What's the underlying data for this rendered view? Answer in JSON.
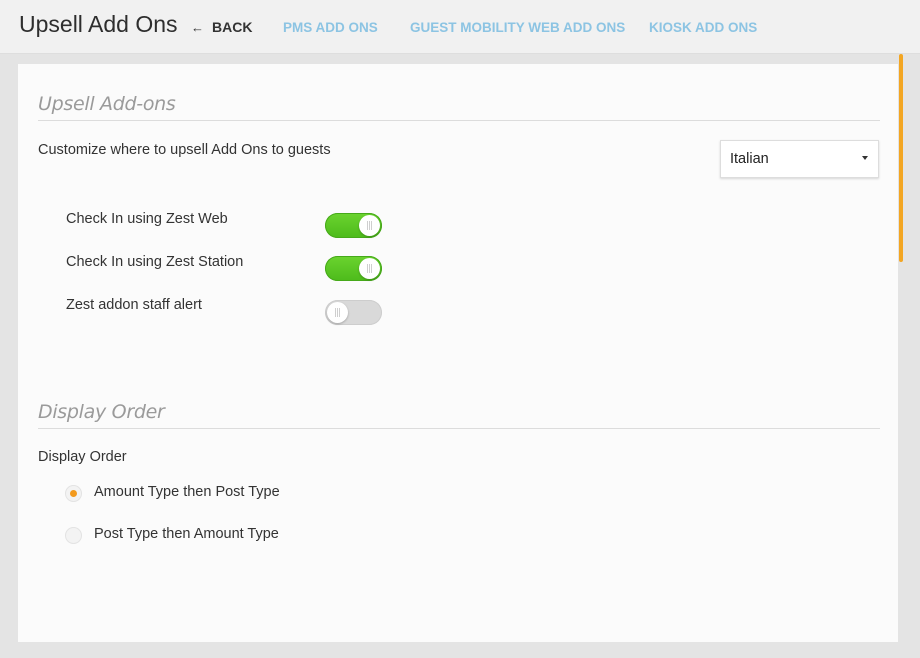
{
  "header": {
    "title": "Upsell Add Ons",
    "back_label": "BACK",
    "tabs": [
      {
        "label": "PMS ADD ONS"
      },
      {
        "label": "GUEST MOBILITY WEB ADD ONS"
      },
      {
        "label": "KIOSK ADD ONS"
      }
    ]
  },
  "upsell_section": {
    "title": "Upsell Add-ons",
    "description": "Customize where to upsell Add Ons to guests",
    "language_select": {
      "selected": "Italian"
    },
    "toggles": [
      {
        "label": "Check In using Zest Web",
        "state": "on"
      },
      {
        "label": "Check In using Zest Station",
        "state": "on"
      },
      {
        "label": "Zest addon staff alert",
        "state": "off"
      }
    ]
  },
  "display_order_section": {
    "title": "Display Order",
    "label": "Display Order",
    "options": [
      {
        "label": "Amount Type then Post Type",
        "selected": true
      },
      {
        "label": "Post Type then Amount Type",
        "selected": false
      }
    ]
  },
  "colors": {
    "accent_orange": "#f39a1d",
    "toggle_on": "#5cc726",
    "tab_blue": "#8cc4e3"
  }
}
